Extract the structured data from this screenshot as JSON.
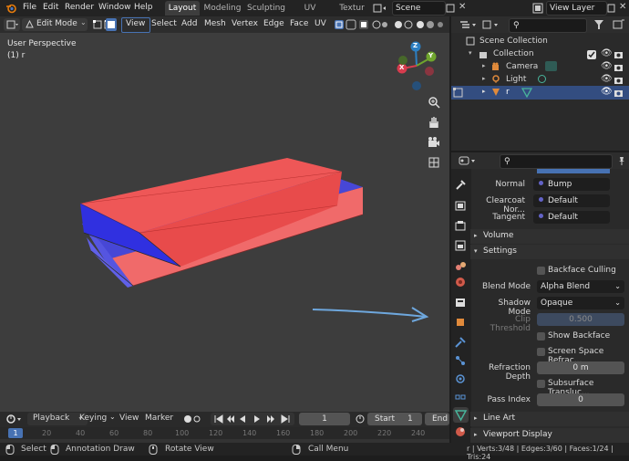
{
  "menus": [
    "File",
    "Edit",
    "Render",
    "Window",
    "Help"
  ],
  "workspaces": [
    {
      "label": "Layout",
      "active": true
    },
    {
      "label": "Modeling"
    },
    {
      "label": "Sculpting"
    },
    {
      "label": "UV Editing"
    },
    {
      "label": "Textur"
    }
  ],
  "scene_name": "Scene",
  "view_layer": "View Layer",
  "viewport": {
    "mode": "Edit Mode",
    "menu": [
      "View",
      "Select",
      "Add",
      "Mesh",
      "Vertex",
      "Edge",
      "Face",
      "UV"
    ],
    "overlay_title": "User Perspective",
    "overlay_sub": "(1) r",
    "gizmo": {
      "z": "Z",
      "y": "Y",
      "x": "X"
    }
  },
  "outliner": {
    "root": "Scene Collection",
    "collection": "Collection",
    "items": [
      "Camera",
      "Light",
      "r"
    ]
  },
  "properties": {
    "normal_label": "Normal",
    "normal_value": "Bump",
    "clearcoat_label": "Clearcoat Nor...",
    "clearcoat_value": "Default",
    "tangent_label": "Tangent",
    "tangent_value": "Default",
    "volume": "Volume",
    "settings": "Settings",
    "backface_culling": "Backface Culling",
    "blend_mode_label": "Blend Mode",
    "blend_mode_value": "Alpha Blend",
    "shadow_mode_label": "Shadow Mode",
    "shadow_mode_value": "Opaque",
    "clip_label": "Clip Threshold",
    "clip_value": "0.500",
    "show_backface": "Show Backface",
    "ssr": "Screen Space Refrac...",
    "refraction_depth_label": "Refraction Depth",
    "refraction_depth_value": "0 m",
    "subsurface": "Subsurface Transluc...",
    "pass_index_label": "Pass Index",
    "pass_index_value": "0",
    "line_art": "Line Art",
    "viewport_display": "Viewport Display"
  },
  "timeline": {
    "menu": [
      "Playback",
      "Keying",
      "View",
      "Marker"
    ],
    "current_frame": "1",
    "start_label": "Start",
    "start_value": "1",
    "end_label": "End",
    "ticks": [
      "0",
      "20",
      "40",
      "60",
      "80",
      "100",
      "120",
      "140",
      "160",
      "180",
      "200",
      "220",
      "240"
    ]
  },
  "status": {
    "select": "Select",
    "annotation": "Annotation Draw",
    "rotate": "Rotate View",
    "call_menu": "Call Menu",
    "stats": "r | Verts:3/48 | Edges:3/60 | Faces:1/24 | Tris:24"
  }
}
